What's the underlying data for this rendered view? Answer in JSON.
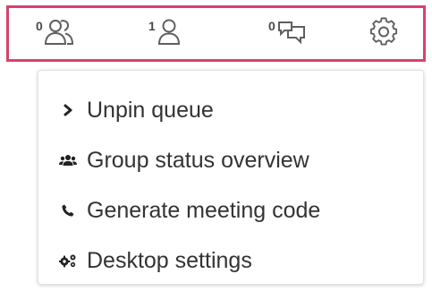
{
  "toolbar": {
    "queue_count": "0",
    "assigned_count": "1",
    "chat_count": "0",
    "border_color": "#d6436e",
    "icons": [
      "users-icon",
      "user-icon",
      "chat-bubbles-icon",
      "gear-icon"
    ]
  },
  "menu": {
    "items": [
      {
        "label": "Unpin queue",
        "icon": "chevron-right-icon"
      },
      {
        "label": "Group status overview",
        "icon": "users-icon"
      },
      {
        "label": "Generate meeting code",
        "icon": "phone-icon"
      },
      {
        "label": "Desktop settings",
        "icon": "cogs-icon"
      }
    ]
  }
}
